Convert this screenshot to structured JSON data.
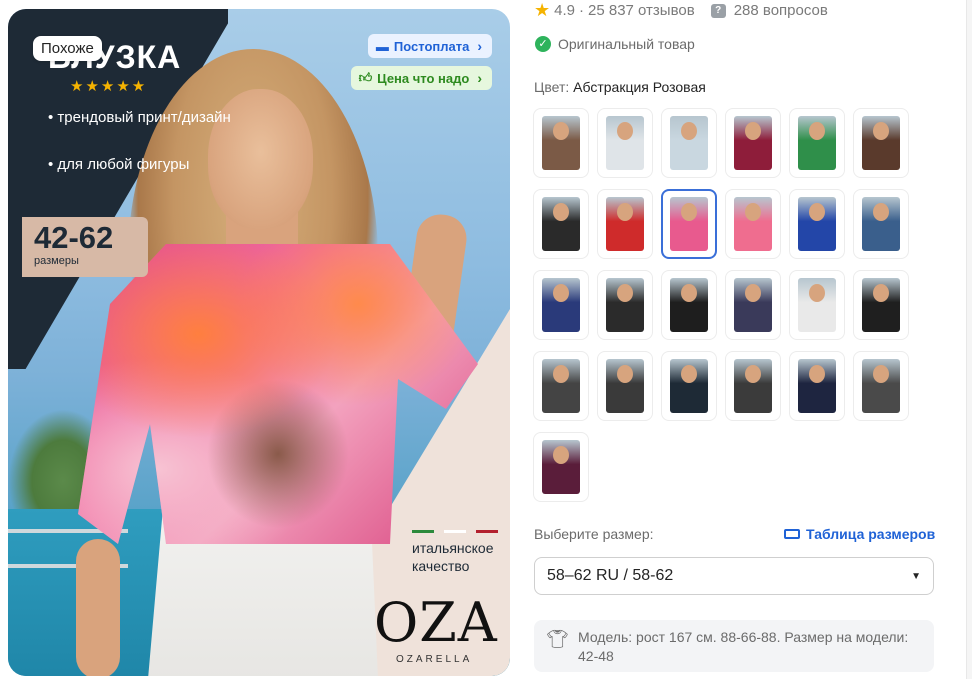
{
  "hero": {
    "similar_chip": "Похоже",
    "title": "БЛУЗКА",
    "stars": "★★★★★",
    "features": [
      "трендовый принт/дизайн",
      "для любой фигуры"
    ],
    "sizes_big": "42-62",
    "sizes_small": "размеры",
    "quality": "итальянское качество",
    "brand": "OZA",
    "brand_sub": "OZARELLA",
    "badge_postpay": "Постоплата",
    "badge_price": "Цена что надо"
  },
  "rating": {
    "score": "4.9",
    "reviews": "25 837 отзывов",
    "questions": "288 вопросов"
  },
  "original_label": "Оригинальный товар",
  "color": {
    "label": "Цвет:",
    "value": "Абстракция Розовая"
  },
  "swatches": [
    {
      "c": "#7b5a46"
    },
    {
      "c": "#dfe4e8"
    },
    {
      "c": "#c9d7e0"
    },
    {
      "c": "#8e1d3a"
    },
    {
      "c": "#2f8f4a"
    },
    {
      "c": "#5a3a2c"
    },
    {
      "c": "#2a2a2a"
    },
    {
      "c": "#cf2b2b"
    },
    {
      "c": "#e85a8e",
      "selected": true
    },
    {
      "c": "#ef6d8f"
    },
    {
      "c": "#2346a8"
    },
    {
      "c": "#3a5f8c"
    },
    {
      "c": "#2a3a7a"
    },
    {
      "c": "#2b2b2b"
    },
    {
      "c": "#1e1e1e"
    },
    {
      "c": "#3a3a5a"
    },
    {
      "c": "#e9e9e9"
    },
    {
      "c": "#1f1f1f"
    },
    {
      "c": "#444444"
    },
    {
      "c": "#3a3a3a"
    },
    {
      "c": "#1e2a36"
    },
    {
      "c": "#3b3b3b"
    },
    {
      "c": "#1e2540"
    },
    {
      "c": "#4a4a4a"
    },
    {
      "c": "#5a1d3a"
    }
  ],
  "size": {
    "label": "Выберите размер:",
    "table_link": "Таблица размеров",
    "selected": "58–62 RU / 58-62"
  },
  "model_info": "Модель: рост 167 см. 88-66-88. Размер на модели: 42-48"
}
